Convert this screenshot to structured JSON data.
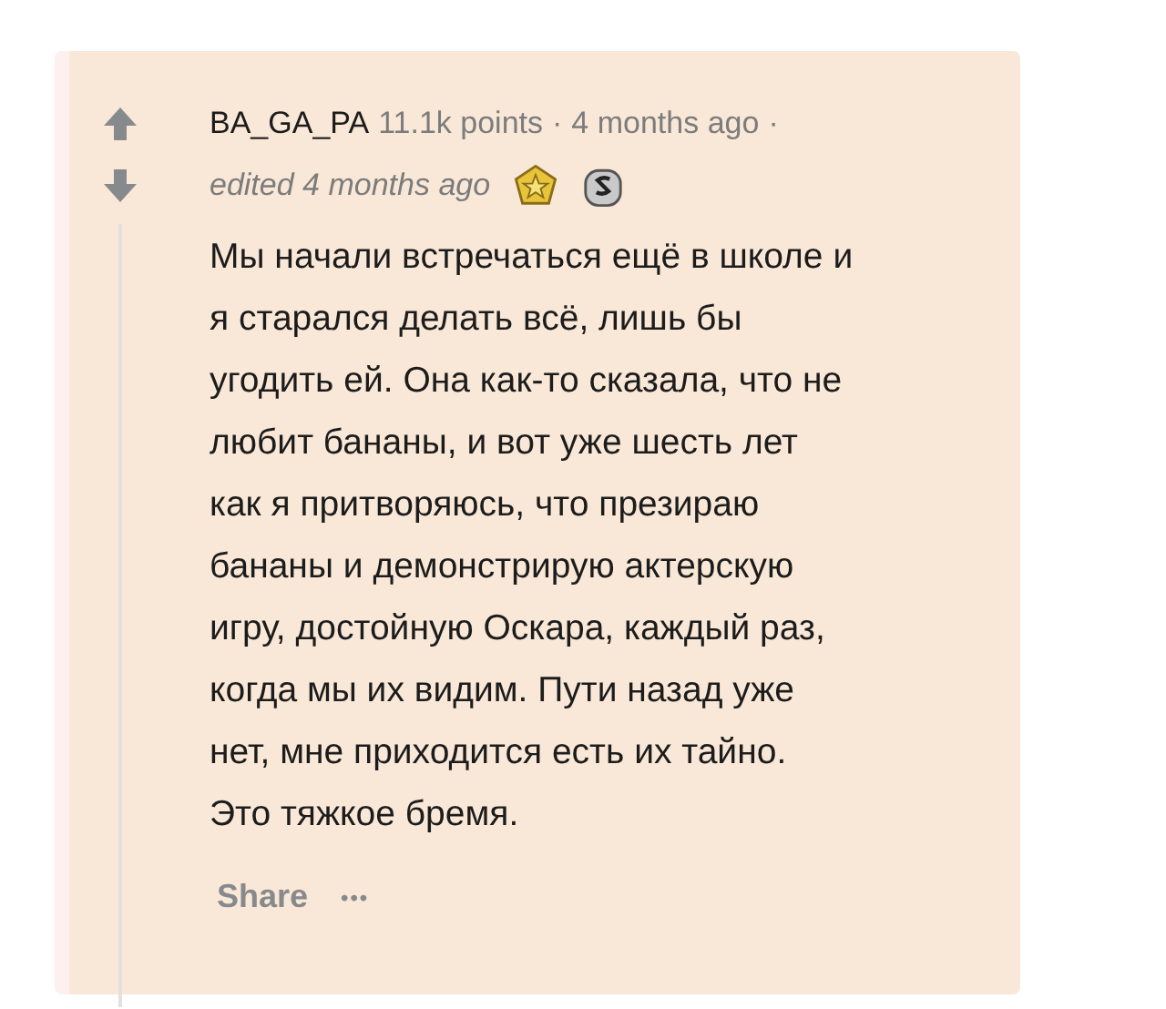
{
  "comment": {
    "author": "BA_GA_PA",
    "points": "11.1k points",
    "separator_1": "·",
    "time": "4 months ago",
    "separator_2": "·",
    "edited": "edited 4 months ago",
    "awards": [
      {
        "kind": "gold"
      },
      {
        "kind": "silver"
      }
    ],
    "body_lines": [
      "Мы начали встречаться ещё в школе и",
      "я старался делать всё, лишь бы",
      "угодить ей. Она как-то сказала, что не",
      "любит бананы, и вот уже шесть лет",
      "как я притворяюсь, что презираю",
      "бананы и демонстрирую актерскую",
      "игру, достойную Оскара, каждый раз,",
      "когда мы их видим. Пути назад уже",
      "нет, мне приходится есть их тайно.",
      "Это тяжкое бремя."
    ],
    "actions": {
      "share": "Share",
      "more": "•••"
    }
  }
}
